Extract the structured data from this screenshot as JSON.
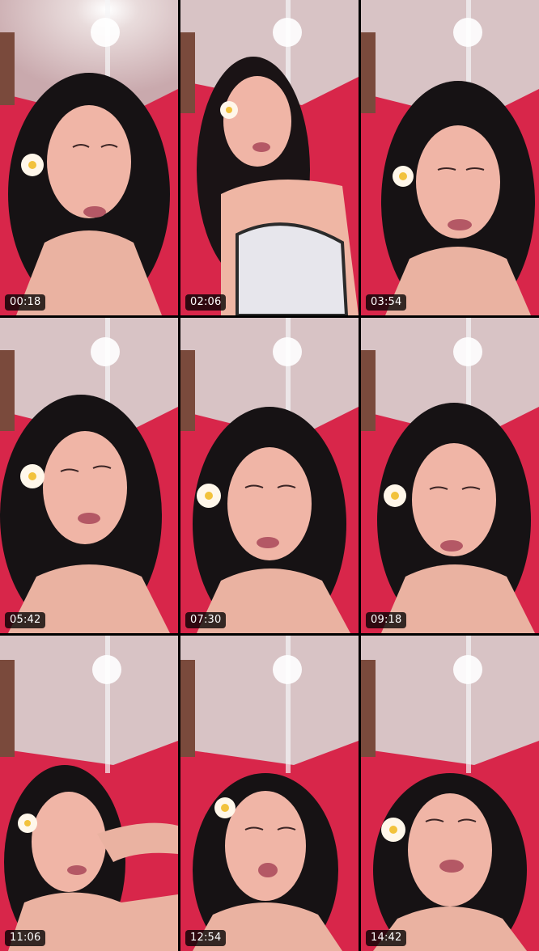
{
  "thumbnails": [
    {
      "timestamp": "00:18"
    },
    {
      "timestamp": "02:06"
    },
    {
      "timestamp": "03:54"
    },
    {
      "timestamp": "05:42"
    },
    {
      "timestamp": "07:30"
    },
    {
      "timestamp": "09:18"
    },
    {
      "timestamp": "11:06"
    },
    {
      "timestamp": "12:54"
    },
    {
      "timestamp": "14:42"
    }
  ]
}
